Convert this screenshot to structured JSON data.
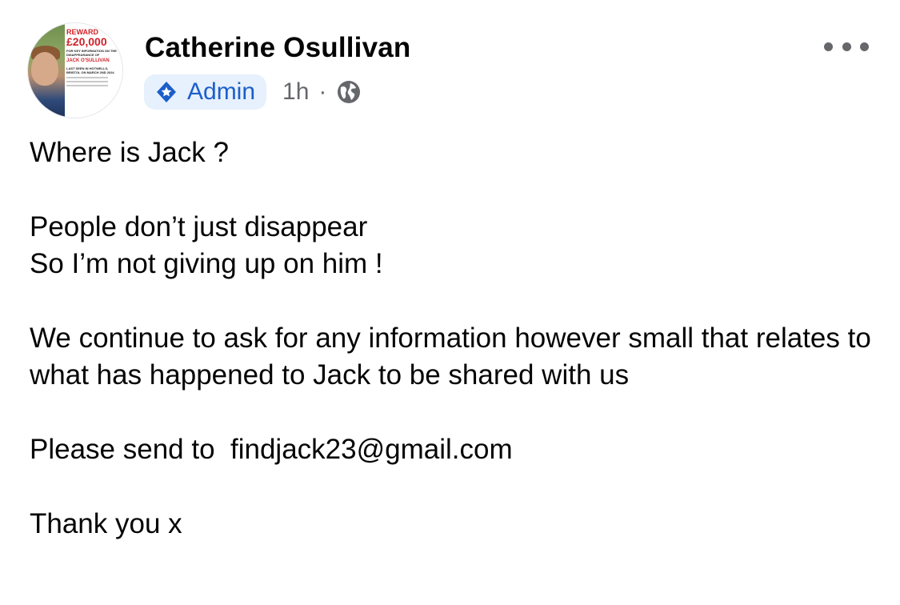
{
  "post": {
    "author": "Catherine Osullivan",
    "badge_label": "Admin",
    "timestamp": "1h",
    "separator": "·",
    "visibility_icon": "globe-icon",
    "more_icon": "more-horizontal-icon",
    "avatar_poster": {
      "reward_label": "REWARD",
      "reward_amount": "£20,000",
      "info_line": "FOR KEY INFORMATION ON THE DISAPPEARANCE OF",
      "name_line": "JACK O'SULLIVAN",
      "seen_line": "LAST SEEN IN HOTWELLS, BRISTOL ON MARCH 2ND 2024"
    },
    "paragraphs": [
      [
        "Where is Jack ?"
      ],
      [
        "People don’t just disappear",
        "So I’m not giving up on him !"
      ],
      [
        "We continue to ask for any information however small that relates to what has happened to Jack to be shared with us"
      ],
      [
        "Please send to  findjack23@gmail.com"
      ],
      [
        "Thank you x"
      ]
    ]
  },
  "colors": {
    "text": "#050505",
    "secondary_text": "#65676b",
    "badge_bg": "#e7f0fd",
    "badge_text": "#1b5fc9",
    "poster_red": "#d0232b"
  }
}
